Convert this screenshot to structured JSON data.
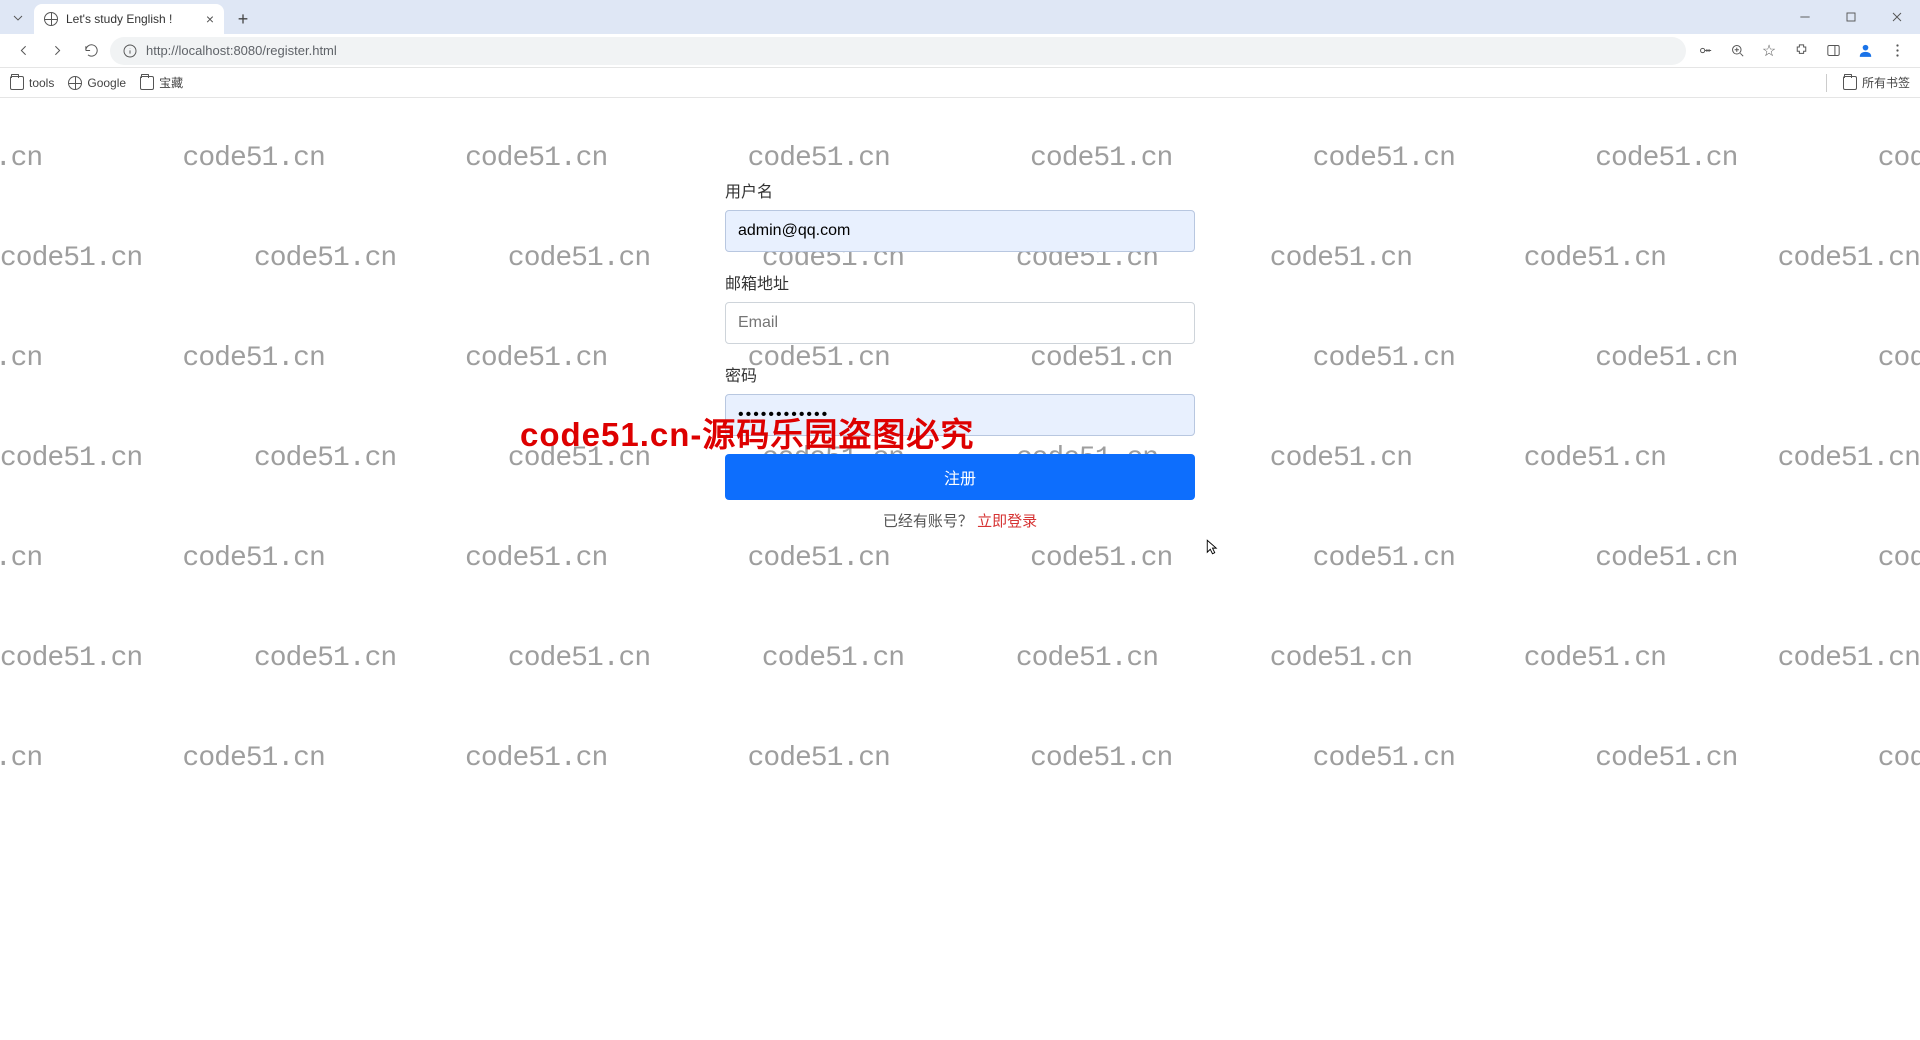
{
  "browser": {
    "tab_title": "Let's study English !",
    "url": "http://localhost:8080/register.html",
    "bookmarks": [
      {
        "type": "folder",
        "label": "tools"
      },
      {
        "type": "site",
        "label": "Google"
      },
      {
        "type": "folder",
        "label": "宝藏"
      }
    ],
    "all_bookmarks_label": "所有书签"
  },
  "form": {
    "username_label": "用户名",
    "username_value": "admin@qq.com",
    "email_label": "邮箱地址",
    "email_placeholder": "Email",
    "email_value": "",
    "password_label": "密码",
    "password_value": "••••••••••••",
    "submit_label": "注册",
    "has_account_text": "已经有账号？",
    "login_link_text": "立即登录"
  },
  "watermark": {
    "text": "code51.cn",
    "overlay": "code51.cn-源码乐园盗图必究"
  }
}
